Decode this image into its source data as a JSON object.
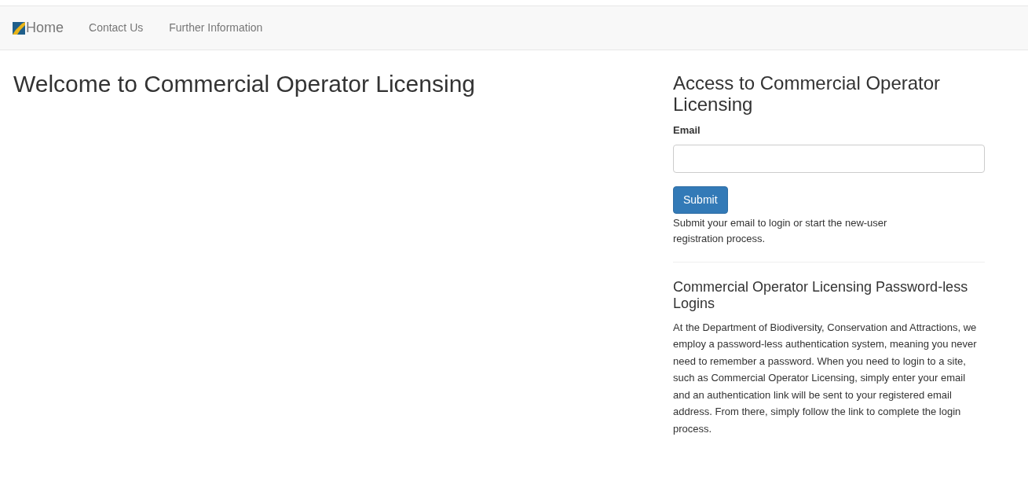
{
  "navbar": {
    "brand": "Home",
    "links": [
      "Contact Us",
      "Further Information"
    ]
  },
  "main": {
    "title": "Welcome to Commercial Operator Licensing"
  },
  "login": {
    "title": "Access to Commercial Operator Licensing",
    "email_label": "Email",
    "submit": "Submit",
    "hint": "Submit your email to login or start the new-user registration process."
  },
  "info": {
    "title": "Commercial Operator Licensing Password-less Logins",
    "text": "At the Department of Biodiversity, Conservation and Attractions, we employ a password-less authentication system, meaning you never need to remember a password. When you need to login to a site, such as Commercial Operator Licensing, simply enter your email and an authentication link will be sent to your registered email address. From there, simply follow the link to complete the login process."
  }
}
